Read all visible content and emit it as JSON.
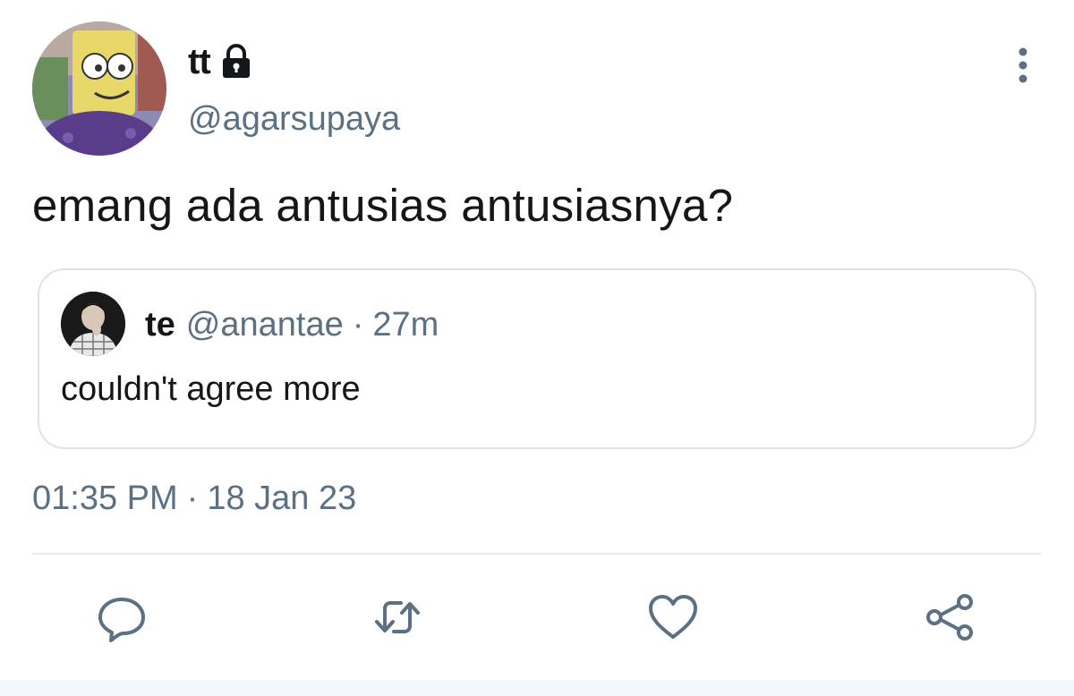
{
  "author": {
    "display_name": "tt",
    "handle": "@agarsupaya",
    "protected_icon": "lock-icon"
  },
  "tweet": {
    "text": "emang ada antusias antusiasnya?",
    "time": "01:35 PM",
    "separator": "·",
    "date": "18 Jan 23"
  },
  "quote": {
    "display_name": "te",
    "handle": "@anantae",
    "separator": "·",
    "age": "27m",
    "text": "couldn't agree more"
  },
  "actions": [
    "reply-icon",
    "retweet-icon",
    "like-icon",
    "share-icon"
  ],
  "colors": {
    "text": "#14171a",
    "secondary": "#5b7083",
    "icon": "#5b7083",
    "border": "#dfe3e7",
    "divider": "#e6ecf0"
  }
}
